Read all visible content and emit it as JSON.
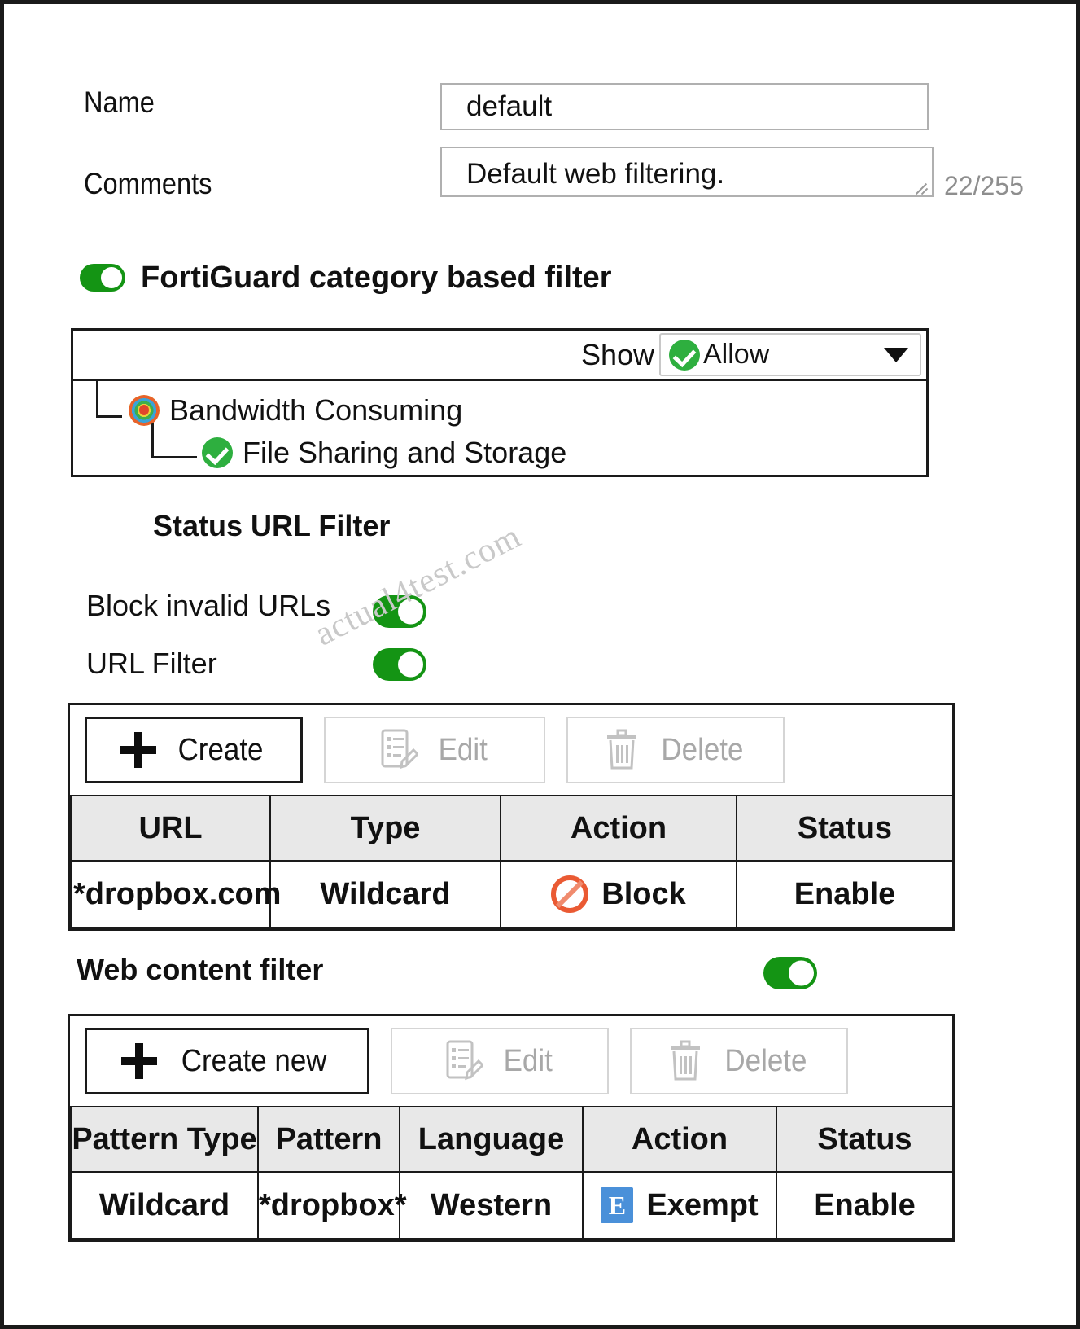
{
  "form": {
    "name_label": "Name",
    "name_value": "default",
    "comments_label": "Comments",
    "comments_value": "Default web filtering.",
    "comments_counter": "22/255"
  },
  "fortiguard": {
    "toggle_label": "FortiGuard category based filter",
    "toggle_state": "on",
    "show_label": "Show",
    "show_value": "Allow",
    "show_icon": "check-circle-icon",
    "tree": [
      {
        "label": "Bandwidth Consuming",
        "icon": "fortiguard-category-icon",
        "level": 0
      },
      {
        "label": "File Sharing and Storage",
        "icon": "check-circle-icon",
        "level": 1
      }
    ]
  },
  "url_filter_section": {
    "section_title": "Status URL Filter",
    "collapse_icon": "minus-square-icon",
    "block_invalid_label": "Block invalid URLs",
    "block_invalid_state": "on",
    "url_filter_label": "URL Filter",
    "url_filter_state": "on",
    "toolbar": {
      "create_label": "Create",
      "create_icon": "plus-icon",
      "create_enabled": true,
      "edit_label": "Edit",
      "edit_icon": "edit-document-icon",
      "edit_enabled": false,
      "delete_label": "Delete",
      "delete_icon": "trash-icon",
      "delete_enabled": false
    },
    "table": {
      "headers": [
        "URL",
        "Type",
        "Action",
        "Status"
      ],
      "rows": [
        {
          "url": "*dropbox.com",
          "type": "Wildcard",
          "action": "Block",
          "action_icon": "block-forbidden-icon",
          "status": "Enable"
        }
      ]
    }
  },
  "web_content_filter": {
    "section_title": "Web content filter",
    "toggle_state": "on",
    "toolbar": {
      "create_label": "Create new",
      "create_icon": "plus-icon",
      "create_enabled": true,
      "edit_label": "Edit",
      "edit_icon": "edit-document-icon",
      "edit_enabled": false,
      "delete_label": "Delete",
      "delete_icon": "trash-icon",
      "delete_enabled": false
    },
    "table": {
      "headers": [
        "Pattern Type",
        "Pattern",
        "Language",
        "Action",
        "Status"
      ],
      "rows": [
        {
          "pattern_type": "Wildcard",
          "pattern": "*dropbox*",
          "language": "Western",
          "action": "Exempt",
          "action_icon": "exempt-e-icon",
          "status": "Enable"
        }
      ]
    }
  },
  "watermark": {
    "text": "actual4test.com"
  },
  "colors": {
    "toggle_on": "#149414",
    "allow_check": "#2eaf3f",
    "block": "#ea5a33",
    "exempt": "#4a90d9",
    "header_bg": "#e8e8e8",
    "disabled_text": "#a8a8a8"
  }
}
